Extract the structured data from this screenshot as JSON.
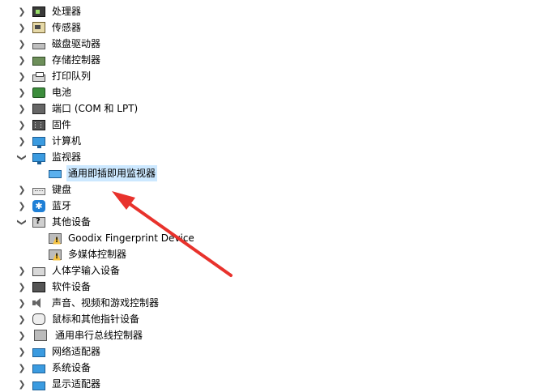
{
  "tree": {
    "items": [
      {
        "label": "处理器",
        "icon": "processor-icon",
        "expanded": false
      },
      {
        "label": "传感器",
        "icon": "sensor-icon",
        "expanded": false
      },
      {
        "label": "磁盘驱动器",
        "icon": "disk-drive-icon",
        "expanded": false
      },
      {
        "label": "存储控制器",
        "icon": "storage-controller-icon",
        "expanded": false
      },
      {
        "label": "打印队列",
        "icon": "printer-icon",
        "expanded": false
      },
      {
        "label": "电池",
        "icon": "battery-icon",
        "expanded": false
      },
      {
        "label": "端口 (COM 和 LPT)",
        "icon": "port-icon",
        "expanded": false
      },
      {
        "label": "固件",
        "icon": "firmware-icon",
        "expanded": false
      },
      {
        "label": "计算机",
        "icon": "computer-icon",
        "expanded": false
      },
      {
        "label": "监视器",
        "icon": "monitor-icon",
        "expanded": true,
        "children": [
          {
            "label": "通用即插即用监视器",
            "icon": "monitor-icon",
            "selected": true
          }
        ]
      },
      {
        "label": "键盘",
        "icon": "keyboard-icon",
        "expanded": false
      },
      {
        "label": "蓝牙",
        "icon": "bluetooth-icon",
        "expanded": false
      },
      {
        "label": "其他设备",
        "icon": "other-devices-icon",
        "expanded": true,
        "children": [
          {
            "label": "Goodix Fingerprint Device",
            "icon": "warning-device-icon"
          },
          {
            "label": "多媒体控制器",
            "icon": "warning-device-icon"
          }
        ]
      },
      {
        "label": "人体学输入设备",
        "icon": "hid-icon",
        "expanded": false
      },
      {
        "label": "软件设备",
        "icon": "software-device-icon",
        "expanded": false
      },
      {
        "label": "声音、视频和游戏控制器",
        "icon": "speaker-icon",
        "expanded": false
      },
      {
        "label": "鼠标和其他指针设备",
        "icon": "mouse-icon",
        "expanded": false
      },
      {
        "label": "通用串行总线控制器",
        "icon": "usb-icon",
        "expanded": false
      },
      {
        "label": "网络适配器",
        "icon": "network-adapter-icon",
        "expanded": false
      },
      {
        "label": "系统设备",
        "icon": "system-device-icon",
        "expanded": false
      },
      {
        "label": "显示适配器",
        "icon": "display-adapter-icon",
        "expanded": false
      }
    ]
  },
  "annotation": {
    "color": "#e8322c"
  }
}
